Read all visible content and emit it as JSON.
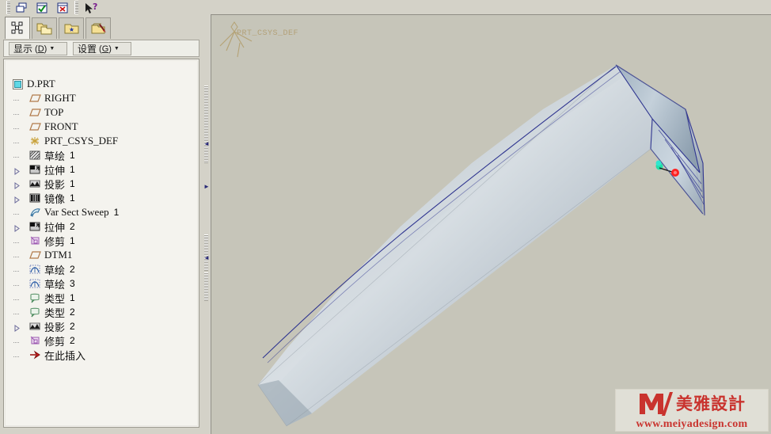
{
  "toolbar": {
    "buttons": [
      {
        "name": "restore-window-icon",
        "label": "Restore Window"
      },
      {
        "name": "accept-check-icon",
        "label": "Accept"
      },
      {
        "name": "cancel-x-icon",
        "label": "Cancel"
      },
      {
        "name": "context-help-icon",
        "label": "Context Help"
      }
    ]
  },
  "tabs": [
    {
      "name": "tab-model-tree",
      "icon": "model-tree-icon",
      "label": "模型树"
    },
    {
      "name": "tab-folder-browser",
      "icon": "folders-icon",
      "label": "文件夹浏览器"
    },
    {
      "name": "tab-favorites",
      "icon": "folder-star-icon",
      "label": "收藏夹"
    },
    {
      "name": "tab-connections",
      "icon": "folder-tool-icon",
      "label": "连接"
    }
  ],
  "panelbar": {
    "show": {
      "text": "显示",
      "accel": "D",
      "caret": "▼"
    },
    "settings": {
      "text": "设置",
      "accel": "G",
      "caret": "▼"
    }
  },
  "tree": {
    "root": {
      "label": "D.PRT",
      "icon": "part-icon"
    },
    "items": [
      {
        "label": "RIGHT",
        "num": "",
        "icon": "datum-plane-icon",
        "expander": false
      },
      {
        "label": "TOP",
        "num": "",
        "icon": "datum-plane-icon",
        "expander": false
      },
      {
        "label": "FRONT",
        "num": "",
        "icon": "datum-plane-icon",
        "expander": false
      },
      {
        "label": "PRT_CSYS_DEF",
        "num": "",
        "icon": "csys-icon",
        "expander": false
      },
      {
        "label": "草绘",
        "num": "1",
        "icon": "sketch-hatch-icon",
        "expander": false
      },
      {
        "label": "拉伸",
        "num": "1",
        "icon": "extrude-icon",
        "expander": true
      },
      {
        "label": "投影",
        "num": "1",
        "icon": "project-icon",
        "expander": true
      },
      {
        "label": "镜像",
        "num": "1",
        "icon": "mirror-icon",
        "expander": true
      },
      {
        "label": "Var Sect Sweep",
        "num": "1",
        "icon": "sweep-icon",
        "expander": false
      },
      {
        "label": "拉伸",
        "num": "2",
        "icon": "extrude-icon",
        "expander": true
      },
      {
        "label": "修剪",
        "num": "1",
        "icon": "trim-icon",
        "expander": false
      },
      {
        "label": "DTM1",
        "num": "",
        "icon": "datum-plane-icon",
        "expander": false
      },
      {
        "label": "草绘",
        "num": "2",
        "icon": "sketch-curve-icon",
        "expander": false
      },
      {
        "label": "草绘",
        "num": "3",
        "icon": "sketch-curve-icon",
        "expander": false
      },
      {
        "label": "类型",
        "num": "1",
        "icon": "surface-icon",
        "expander": false
      },
      {
        "label": "类型",
        "num": "2",
        "icon": "surface-icon",
        "expander": false
      },
      {
        "label": "投影",
        "num": "2",
        "icon": "project-icon",
        "expander": true
      },
      {
        "label": "修剪",
        "num": "2",
        "icon": "trim-icon",
        "expander": false
      },
      {
        "label": "在此插入",
        "num": "",
        "icon": "insert-here-icon",
        "expander": false
      }
    ]
  },
  "viewport": {
    "csys_label": "PRT_CSYS_DEF",
    "background_color": "#c6c5b9",
    "model_color": "#aeb7c0",
    "curve_color": "#3b3fa0"
  },
  "watermark": {
    "brand_cn": "美雅設計",
    "url": "www.meiyadesign.com",
    "color": "#c9332e"
  }
}
